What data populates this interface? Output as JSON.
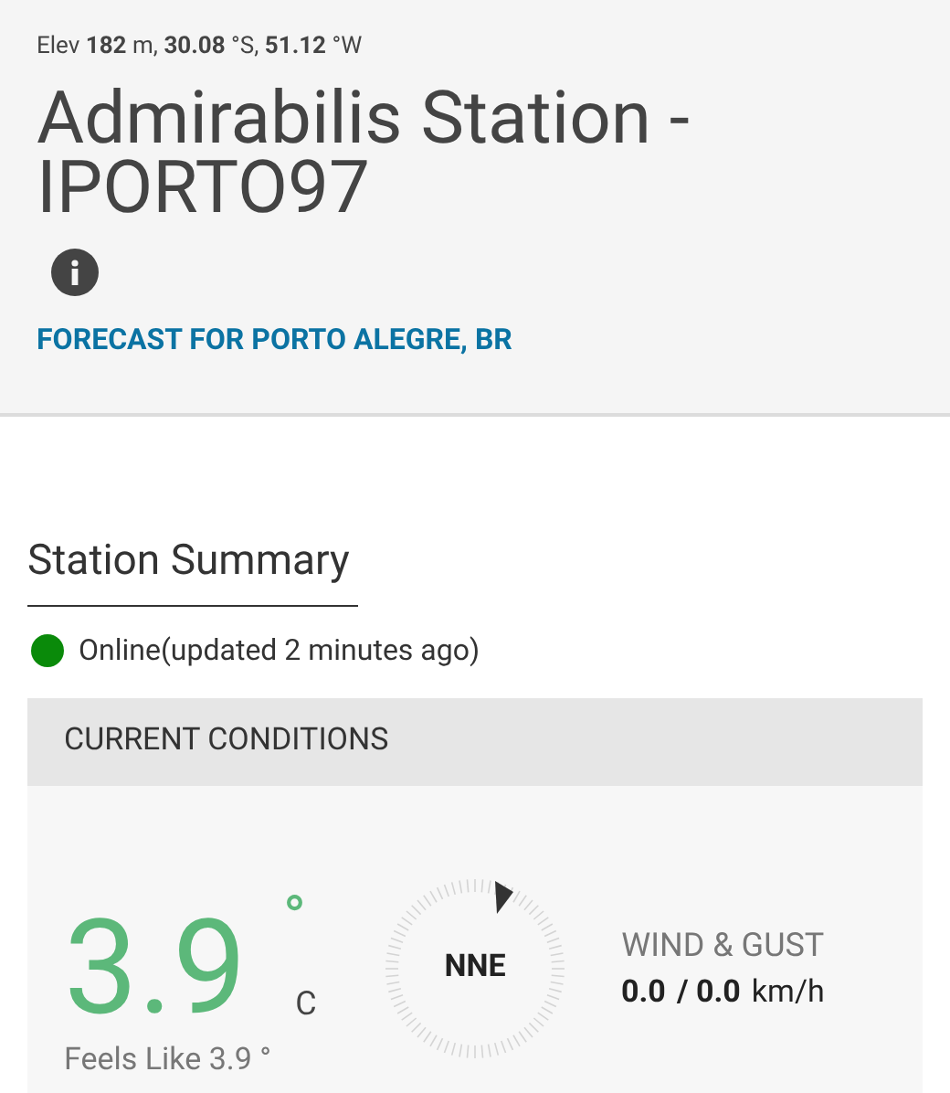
{
  "header": {
    "location_line": "Elev **182** m, **30.08** °S, **51.12** °W",
    "title": "Admirabilis Station - IPORTO97",
    "forecast_link": "FORECAST FOR PORTO ALEGRE, BR"
  },
  "summary": {
    "heading": "Station Summary",
    "online": true,
    "status": "Online(updated 2 minutes ago)"
  },
  "current_conditions": {
    "heading": "CURRENT CONDITIONS",
    "temperature": "3.9",
    "degree": "°",
    "unit": "C",
    "feels_like": "Feels Like 3.9 °",
    "wind_direction": "NNE",
    "wind_label": "WIND & GUST",
    "wind_speed": "0.0",
    "gust_speed": "/ 0.0",
    "wind_unit": "km/h"
  }
}
